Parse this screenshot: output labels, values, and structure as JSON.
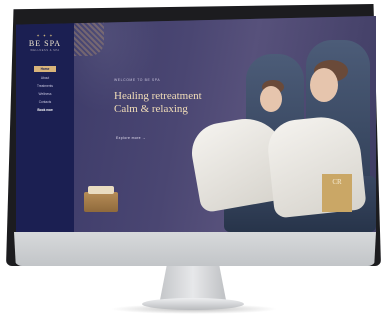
{
  "brand": {
    "stars": "✦ ✦ ✦",
    "name": "BE SPA",
    "tagline": "WELLNESS & SPA"
  },
  "nav": {
    "items": [
      {
        "label": "Home",
        "state": "active"
      },
      {
        "label": "About"
      },
      {
        "label": "Treatments"
      },
      {
        "label": "Wellness"
      },
      {
        "label": "Contacts"
      },
      {
        "label": "Book now",
        "state": "strong"
      }
    ]
  },
  "hero": {
    "welcome": "WELCOME TO BE SPA",
    "headline_line1": "Healing retreatment",
    "headline_line2": "Calm & relaxing",
    "link": "Explore more →",
    "badge": "CR"
  },
  "colors": {
    "sidebar": "#1b1f52",
    "accent_gold": "#d9b47a",
    "headline": "#f1ddb8"
  }
}
